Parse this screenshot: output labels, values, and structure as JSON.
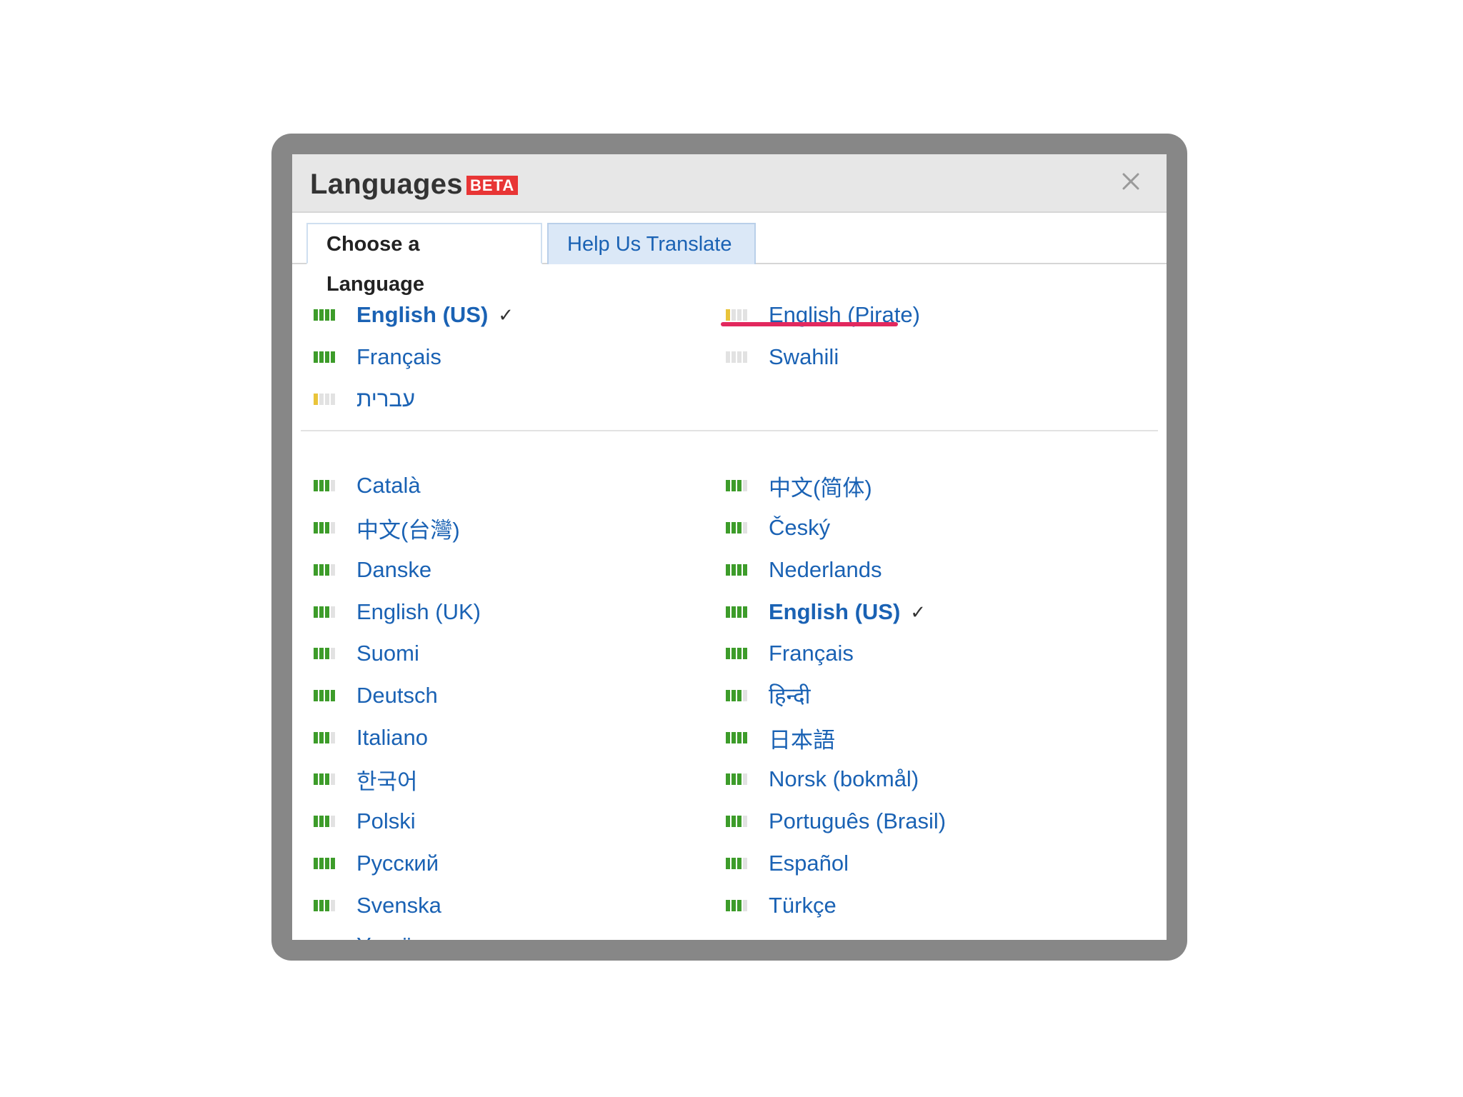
{
  "dialog": {
    "title": "Languages",
    "badge": "BETA",
    "close_label": "×"
  },
  "tabs": [
    {
      "label": "Choose a Language",
      "active": true
    },
    {
      "label": "Help Us Translate",
      "active": false
    }
  ],
  "featured": [
    {
      "name": "English (US)",
      "level": "full",
      "selected": true,
      "check": "✓"
    },
    {
      "name": "English (Pirate)",
      "level": "low",
      "selected": false,
      "highlighted": true
    },
    {
      "name": "Français",
      "level": "full",
      "selected": false
    },
    {
      "name": "Swahili",
      "level": "none",
      "selected": false
    },
    {
      "name": "עברית",
      "level": "low",
      "selected": false
    }
  ],
  "languages_left": [
    {
      "name": "Català",
      "level": "high"
    },
    {
      "name": "中文(台灣)",
      "level": "high"
    },
    {
      "name": "Danske",
      "level": "high"
    },
    {
      "name": "English (UK)",
      "level": "high"
    },
    {
      "name": "Suomi",
      "level": "high"
    },
    {
      "name": "Deutsch",
      "level": "full"
    },
    {
      "name": "Italiano",
      "level": "high"
    },
    {
      "name": "한국어",
      "level": "high"
    },
    {
      "name": "Polski",
      "level": "high"
    },
    {
      "name": "Русский",
      "level": "full"
    },
    {
      "name": "Svenska",
      "level": "high"
    },
    {
      "name": "Українська",
      "level": "full"
    }
  ],
  "languages_right": [
    {
      "name": "中文(简体)",
      "level": "high"
    },
    {
      "name": "Český",
      "level": "high"
    },
    {
      "name": "Nederlands",
      "level": "full"
    },
    {
      "name": "English (US)",
      "level": "full",
      "selected": true,
      "check": "✓"
    },
    {
      "name": "Français",
      "level": "full"
    },
    {
      "name": "हिन्दी",
      "level": "high"
    },
    {
      "name": "日本語",
      "level": "full"
    },
    {
      "name": "Norsk (bokmål)",
      "level": "high"
    },
    {
      "name": "Português (Brasil)",
      "level": "high"
    },
    {
      "name": "Español",
      "level": "high"
    },
    {
      "name": "Türkçe",
      "level": "high"
    }
  ],
  "colors": {
    "frame": "#878787",
    "link": "#1a62b4",
    "bar_green": "#3d9c2a",
    "bar_yellow": "#e9c43a",
    "beta_red": "#e83535",
    "highlight_underline": "#e2285e"
  }
}
